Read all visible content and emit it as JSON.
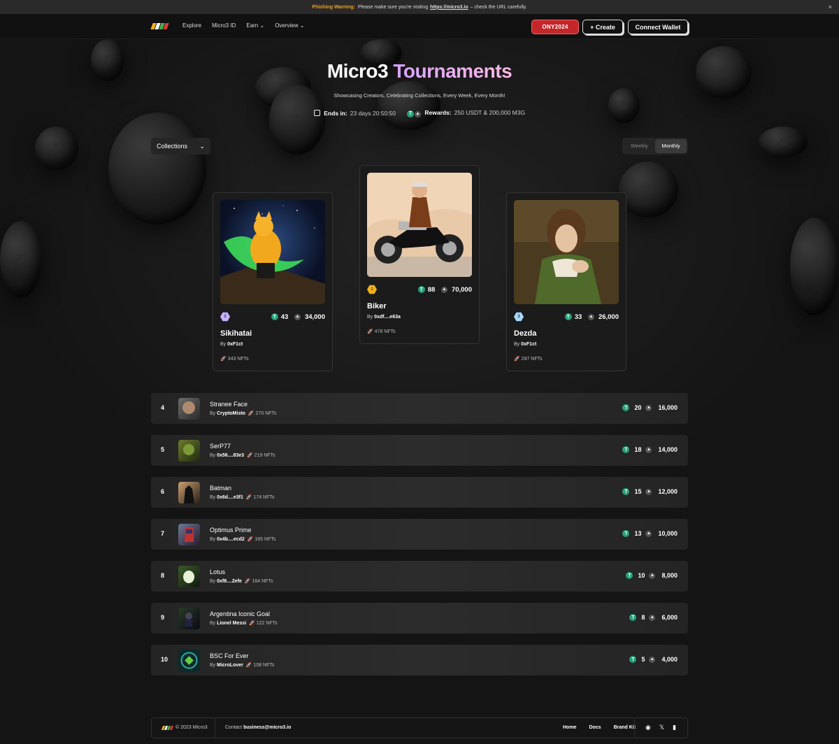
{
  "banner": {
    "warning_label": "Phishing Warning:",
    "text_before": "Please make sure you're visiting",
    "url": "https://micro3.io",
    "text_after": "– check the URL carefully.",
    "close": "×"
  },
  "nav": {
    "links": [
      "Explore",
      "Micro3 ID",
      "Earn ⌄",
      "Overview ⌄"
    ],
    "promo_label": "ONY2024",
    "create_label": "+ Create",
    "wallet_label": "Connect Wallet"
  },
  "hero": {
    "title_main": "Micro3",
    "title_accent": "Tournaments",
    "subtitle": "Showcasing Creators, Celebrating Collections, Every Week, Every Month!",
    "ends_label": "Ends in:",
    "ends_value": "23 days 20:50:50",
    "rewards_label": "Rewards:",
    "rewards_value": "250 USDT & 200,000 M3G"
  },
  "filters": {
    "category": "Collections",
    "periods": [
      "Weekly",
      "Monthly"
    ],
    "active_period": "Monthly"
  },
  "podium": [
    {
      "rank": "2",
      "usdt": "43",
      "m3g": "34,000",
      "name": "Sikihatai",
      "by": "0xF1ct",
      "nfts": "343 NFTs"
    },
    {
      "rank": "1",
      "usdt": "88",
      "m3g": "70,000",
      "name": "Biker",
      "by": "0xdf....e63a",
      "nfts": "478 NFTs"
    },
    {
      "rank": "3",
      "usdt": "33",
      "m3g": "26,000",
      "name": "Dezda",
      "by": "0xF1ct",
      "nfts": "287 NFTs"
    }
  ],
  "leaderboard": [
    {
      "rank": "4",
      "name": "Stranee Face",
      "by": "CryptoMisto",
      "nfts": "270 NFTs",
      "usdt": "20",
      "m3g": "16,000"
    },
    {
      "rank": "5",
      "name": "SerP77",
      "by": "0x56....83e3",
      "nfts": "219 NFTs",
      "usdt": "18",
      "m3g": "14,000"
    },
    {
      "rank": "6",
      "name": "Batman",
      "by": "0x6d....e3f1",
      "nfts": "174 NFTs",
      "usdt": "15",
      "m3g": "12,000"
    },
    {
      "rank": "7",
      "name": "Optimus Prime",
      "by": "0x4b....ecd2",
      "nfts": "165 NFTs",
      "usdt": "13",
      "m3g": "10,000"
    },
    {
      "rank": "8",
      "name": "Lotus",
      "by": "0xf8....2efe",
      "nfts": "164 NFTs",
      "usdt": "10",
      "m3g": "8,000"
    },
    {
      "rank": "9",
      "name": "Argentina Iconic Goal",
      "by": "Lionel Messi",
      "nfts": "122 NFTs",
      "usdt": "8",
      "m3g": "6,000"
    },
    {
      "rank": "10",
      "name": "BSC For Ever",
      "by": "MicroLover",
      "nfts": "108 NFTs",
      "usdt": "5",
      "m3g": "4,000"
    }
  ],
  "footer": {
    "copyright": "© 2023 Micro3",
    "contact_label": "Contact",
    "contact_email": "business@micro3.io",
    "links": [
      "Home",
      "Docs",
      "Brand Kit"
    ],
    "social": [
      "discord-icon",
      "x-icon",
      "medium-icon"
    ]
  },
  "colors": {
    "accent_purple": "#d6a2ff",
    "usdt_green": "#26a17b",
    "promo_red": "#c4272a",
    "gold": "#f2b21b",
    "silver": "#c7b2ff",
    "bronze": "#a9d8ff"
  }
}
